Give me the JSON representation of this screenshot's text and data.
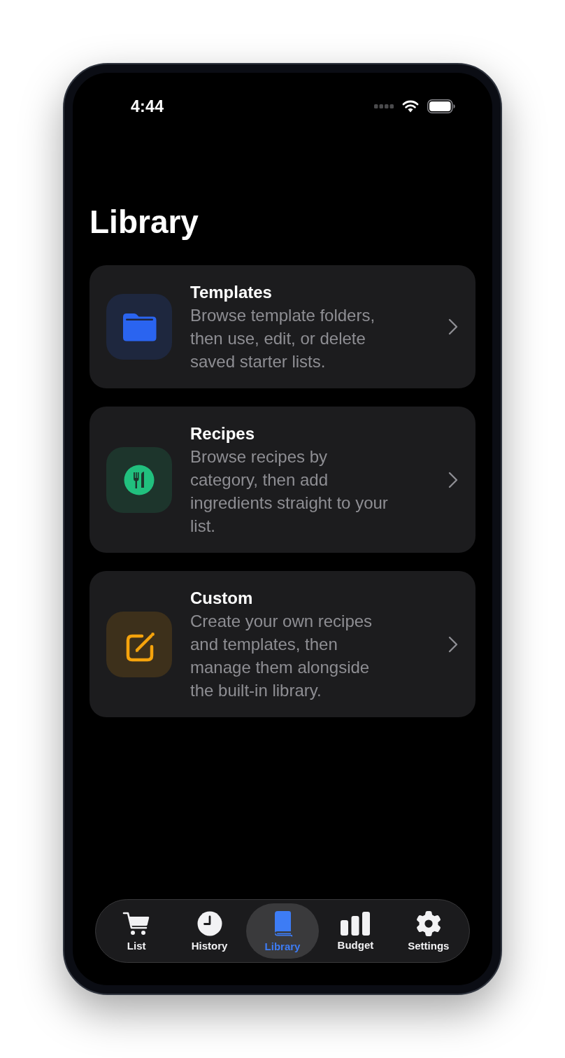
{
  "status_bar": {
    "time": "4:44"
  },
  "title": "Library",
  "cards": [
    {
      "kind": "folder",
      "color": "#2a64f0",
      "title": "Templates",
      "description": "Browse template folders, then use, edit, or delete saved starter lists."
    },
    {
      "kind": "utensils",
      "color": "#21c07e",
      "title": "Recipes",
      "description": "Browse recipes by category, then add ingredients straight to your list."
    },
    {
      "kind": "edit",
      "color": "#f5a30c",
      "title": "Custom",
      "description": "Create your own recipes and templates, then manage them alongside the built-in library."
    }
  ],
  "tab_bar": {
    "tabs": [
      {
        "kind": "cart",
        "label": "List",
        "selected": false
      },
      {
        "kind": "clock",
        "label": "History",
        "selected": false
      },
      {
        "kind": "book",
        "label": "Library",
        "selected": true
      },
      {
        "kind": "chart",
        "label": "Budget",
        "selected": false
      },
      {
        "kind": "gear",
        "label": "Settings",
        "selected": false
      }
    ]
  }
}
